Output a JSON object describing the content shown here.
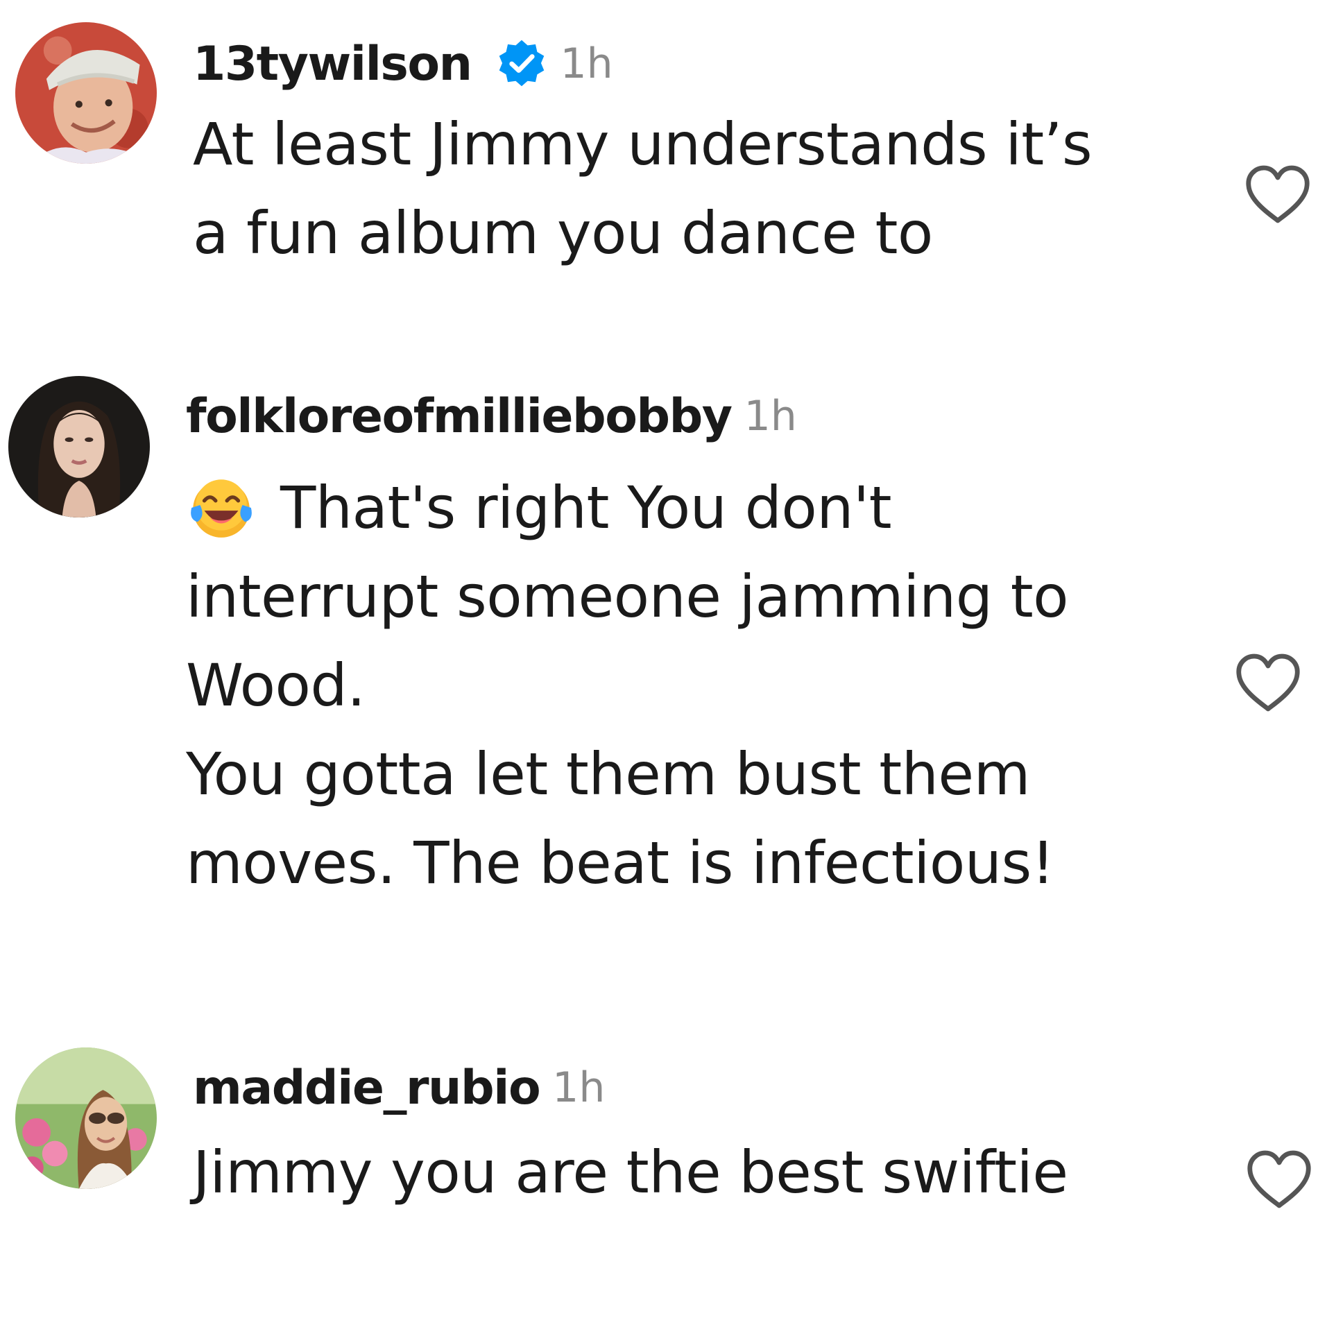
{
  "comments": [
    {
      "username": "13tywilson",
      "verified": true,
      "time": "1h",
      "lines": [
        "At least Jimmy understands it’s",
        "a fun album you dance to"
      ],
      "avatar_icon": "user-avatar-cap",
      "like_icon": "heart-outline-icon"
    },
    {
      "username": "folkloreofmilliebobby",
      "verified": false,
      "time": "1h",
      "emoji": "face-with-tears-of-joy",
      "lines": [
        "That's right You don't",
        "interrupt someone jamming to",
        "Wood.",
        "You gotta let them bust them",
        "moves. The beat is infectious!"
      ],
      "avatar_icon": "user-avatar-portrait",
      "like_icon": "heart-outline-icon"
    },
    {
      "username": "maddie_rubio",
      "verified": false,
      "time": "1h",
      "lines": [
        "Jimmy you are the best swiftie"
      ],
      "avatar_icon": "user-avatar-garden",
      "like_icon": "heart-outline-icon"
    }
  ],
  "colors": {
    "verified_blue": "#0095f6",
    "time_gray": "#8a8a8a",
    "text": "#1a1a1a",
    "heart_stroke": "#555555"
  }
}
